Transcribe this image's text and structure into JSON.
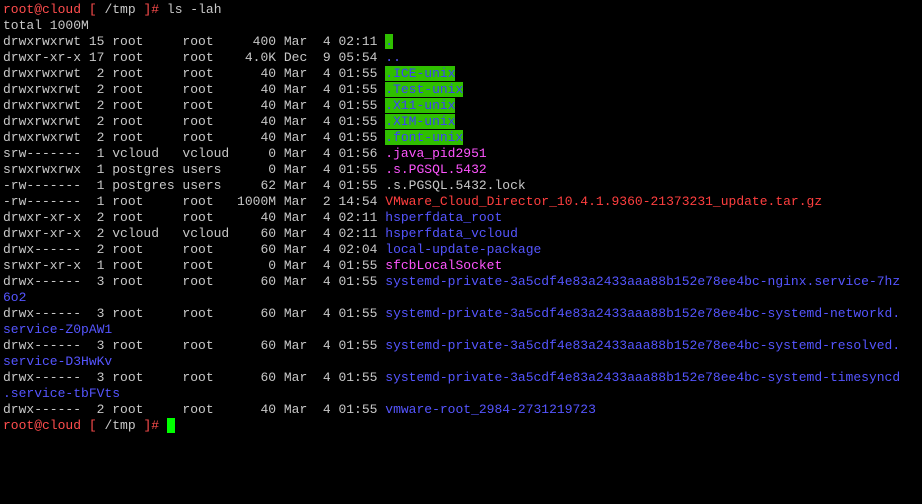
{
  "prompt": {
    "user": "root",
    "at": "@",
    "host": "cloud",
    "open": " [ ",
    "path": "/tmp",
    "close": " ]",
    "hash": "# "
  },
  "command": "ls -lah",
  "total": "total 1000M",
  "colors": {
    "background": "#000000",
    "text": "#c8c8c8",
    "prompt": "#ff4d4d",
    "directory": "#5555ff",
    "socket": "#ff55ff",
    "archive": "#ff3f3f",
    "sticky_bg": "#2fbf00",
    "cursor": "#00ff00"
  },
  "entries": [
    {
      "info": "drwxrwxrwt 15 root     root     400 Mar  4 02:11 ",
      "name": ".",
      "kind": "sticky"
    },
    {
      "info": "drwxr-xr-x 17 root     root    4.0K Dec  9 05:54 ",
      "name": "..",
      "kind": "dir"
    },
    {
      "info": "drwxrwxrwt  2 root     root      40 Mar  4 01:55 ",
      "name": ".ICE-unix",
      "kind": "sticky"
    },
    {
      "info": "drwxrwxrwt  2 root     root      40 Mar  4 01:55 ",
      "name": ".Test-unix",
      "kind": "sticky"
    },
    {
      "info": "drwxrwxrwt  2 root     root      40 Mar  4 01:55 ",
      "name": ".X11-unix",
      "kind": "sticky"
    },
    {
      "info": "drwxrwxrwt  2 root     root      40 Mar  4 01:55 ",
      "name": ".XIM-unix",
      "kind": "sticky"
    },
    {
      "info": "drwxrwxrwt  2 root     root      40 Mar  4 01:55 ",
      "name": ".font-unix",
      "kind": "sticky"
    },
    {
      "info": "srw-------  1 vcloud   vcloud     0 Mar  4 01:56 ",
      "name": ".java_pid2951",
      "kind": "sock"
    },
    {
      "info": "srwxrwxrwx  1 postgres users      0 Mar  4 01:55 ",
      "name": ".s.PGSQL.5432",
      "kind": "sock"
    },
    {
      "info": "-rw-------  1 postgres users     62 Mar  4 01:55 ",
      "name": ".s.PGSQL.5432.lock",
      "kind": "file"
    },
    {
      "info": "-rw-------  1 root     root   1000M Mar  2 14:54 ",
      "name": "VMware_Cloud_Director_10.4.1.9360-21373231_update.tar.gz",
      "kind": "arch"
    },
    {
      "info": "drwxr-xr-x  2 root     root      40 Mar  4 02:11 ",
      "name": "hsperfdata_root",
      "kind": "dir"
    },
    {
      "info": "drwxr-xr-x  2 vcloud   vcloud    60 Mar  4 02:11 ",
      "name": "hsperfdata_vcloud",
      "kind": "dir"
    },
    {
      "info": "drwx------  2 root     root      60 Mar  4 02:04 ",
      "name": "local-update-package",
      "kind": "dir"
    },
    {
      "info": "srwxr-xr-x  1 root     root       0 Mar  4 01:55 ",
      "name": "sfcbLocalSocket",
      "kind": "sock"
    },
    {
      "info": "drwx------  3 root     root      60 Mar  4 01:55 ",
      "name": "systemd-private-3a5cdf4e83a2433aaa88b152e78ee4bc-nginx.service-7hz",
      "kind": "dir"
    },
    {
      "info": "",
      "name": "6o2",
      "kind": "dir"
    },
    {
      "info": "drwx------  3 root     root      60 Mar  4 01:55 ",
      "name": "systemd-private-3a5cdf4e83a2433aaa88b152e78ee4bc-systemd-networkd.",
      "kind": "dir"
    },
    {
      "info": "",
      "name": "service-Z0pAW1",
      "kind": "dir"
    },
    {
      "info": "drwx------  3 root     root      60 Mar  4 01:55 ",
      "name": "systemd-private-3a5cdf4e83a2433aaa88b152e78ee4bc-systemd-resolved.",
      "kind": "dir"
    },
    {
      "info": "",
      "name": "service-D3HwKv",
      "kind": "dir"
    },
    {
      "info": "drwx------  3 root     root      60 Mar  4 01:55 ",
      "name": "systemd-private-3a5cdf4e83a2433aaa88b152e78ee4bc-systemd-timesyncd",
      "kind": "dir"
    },
    {
      "info": "",
      "name": ".service-tbFVts",
      "kind": "dir"
    },
    {
      "info": "drwx------  2 root     root      40 Mar  4 01:55 ",
      "name": "vmware-root_2984-2731219723",
      "kind": "dir"
    }
  ]
}
